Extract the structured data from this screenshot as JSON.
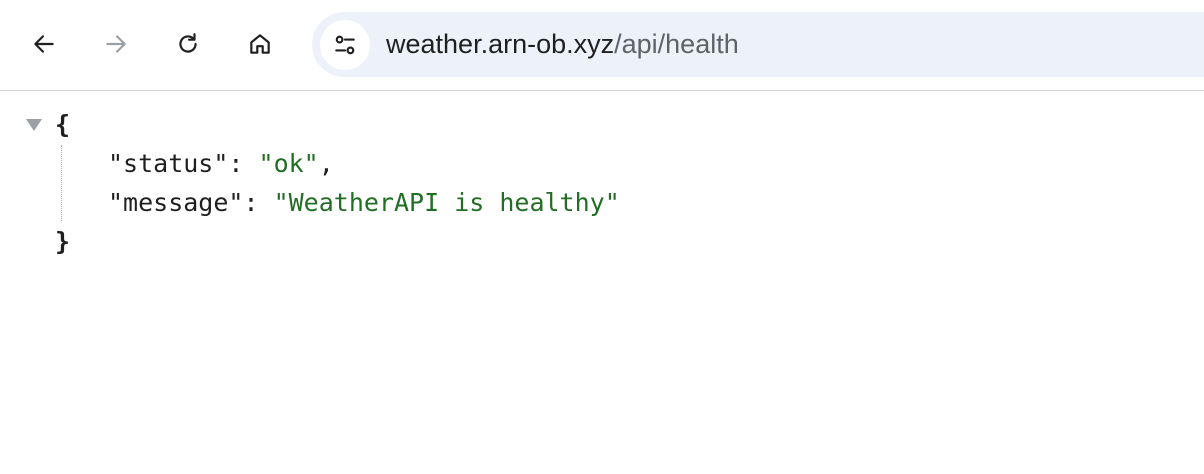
{
  "browser": {
    "url_host": "weather.arn-ob.xyz",
    "url_path": "/api/health"
  },
  "json_viewer": {
    "open_brace": "{",
    "close_brace": "}",
    "entries": [
      {
        "key": "\"status\"",
        "separator": ": ",
        "value": "\"ok\"",
        "trailing": ","
      },
      {
        "key": "\"message\"",
        "separator": ": ",
        "value": "\"WeatherAPI is healthy\"",
        "trailing": ""
      }
    ]
  },
  "colors": {
    "string_value": "#236e25",
    "omnibox_bg": "#edf2fa",
    "icon": "#1f1f1f",
    "icon_disabled": "#9aa0a6"
  },
  "icons": {
    "back": "arrow-left-icon",
    "forward": "arrow-right-icon",
    "reload": "reload-icon",
    "home": "home-icon",
    "site_info": "tune-icon",
    "fold": "triangle-down-icon"
  }
}
